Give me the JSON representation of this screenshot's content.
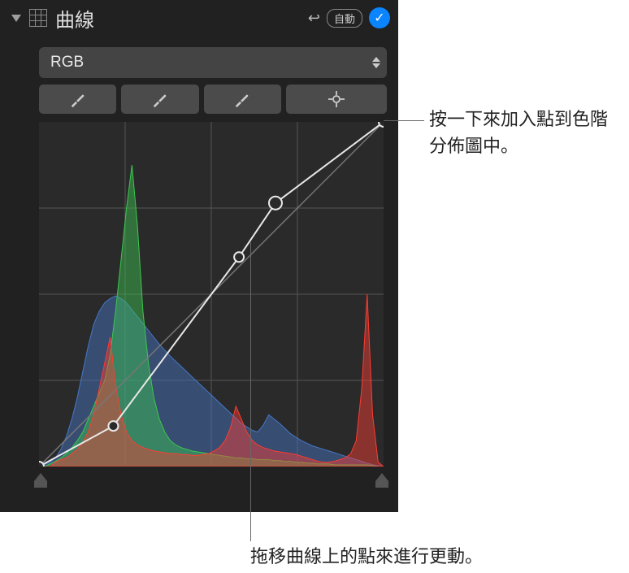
{
  "header": {
    "title": "曲線",
    "auto_label": "自動"
  },
  "channel": {
    "selected": "RGB"
  },
  "tools": {
    "black_eyedropper": "black-point-eyedropper",
    "gray_eyedropper": "gray-point-eyedropper",
    "white_eyedropper": "white-point-eyedropper",
    "add_point": "add-point"
  },
  "annotations": {
    "add_point_tip": "按一下來加入點到色階分佈圖中。",
    "drag_point_tip": "拖移曲線上的點來進行更動。"
  },
  "chart_data": {
    "type": "curve+histogram",
    "x_range": [
      0,
      255
    ],
    "y_range": [
      0,
      255
    ],
    "curve_points": [
      {
        "x": 0,
        "y": 0
      },
      {
        "x": 55,
        "y": 30
      },
      {
        "x": 148,
        "y": 155
      },
      {
        "x": 175,
        "y": 195
      },
      {
        "x": 255,
        "y": 255
      }
    ],
    "histogram": {
      "red": [
        0,
        0,
        0,
        5,
        8,
        10,
        15,
        20,
        28,
        40,
        60,
        90,
        120,
        150,
        95,
        60,
        40,
        30,
        25,
        22,
        20,
        18,
        17,
        16,
        15,
        15,
        14,
        14,
        13,
        13,
        14,
        15,
        18,
        22,
        30,
        45,
        70,
        55,
        40,
        30,
        25,
        22,
        20,
        18,
        17,
        16,
        15,
        14,
        12,
        10,
        8,
        6,
        5,
        5,
        6,
        8,
        10,
        15,
        30,
        90,
        200,
        60,
        5,
        0
      ],
      "green": [
        0,
        0,
        3,
        6,
        10,
        15,
        22,
        30,
        40,
        55,
        70,
        85,
        100,
        130,
        180,
        240,
        300,
        350,
        280,
        180,
        120,
        80,
        55,
        40,
        30,
        25,
        22,
        20,
        18,
        17,
        16,
        15,
        14,
        13,
        12,
        11,
        10,
        10,
        9,
        9,
        8,
        8,
        8,
        7,
        7,
        6,
        6,
        5,
        5,
        4,
        4,
        3,
        3,
        3,
        2,
        2,
        2,
        2,
        2,
        2,
        2,
        1,
        0,
        0
      ],
      "blue": [
        0,
        2,
        5,
        10,
        20,
        35,
        55,
        80,
        110,
        140,
        165,
        180,
        190,
        195,
        198,
        195,
        190,
        182,
        174,
        166,
        158,
        150,
        142,
        135,
        128,
        122,
        116,
        110,
        104,
        98,
        92,
        86,
        80,
        74,
        68,
        62,
        56,
        50,
        46,
        42,
        40,
        48,
        60,
        55,
        50,
        44,
        38,
        34,
        30,
        27,
        24,
        22,
        20,
        18,
        16,
        14,
        12,
        10,
        8,
        6,
        4,
        2,
        1,
        0
      ]
    },
    "slider": {
      "black": 0,
      "white": 255
    }
  }
}
